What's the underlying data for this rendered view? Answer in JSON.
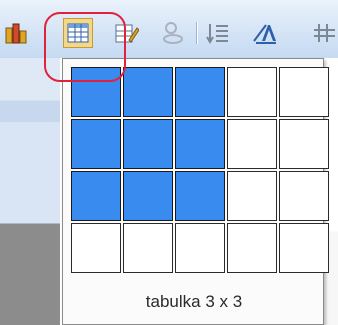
{
  "toolbar": {
    "buttons": [
      {
        "name": "chart-icon"
      },
      {
        "name": "insert-table-icon"
      },
      {
        "name": "draw-table-icon"
      },
      {
        "name": "hyperlink-icon"
      },
      {
        "name": "sort-icon"
      },
      {
        "name": "text-direction-icon"
      },
      {
        "name": "borders-icon"
      }
    ]
  },
  "table_picker": {
    "rows": 4,
    "cols": 5,
    "selected_rows": 3,
    "selected_cols": 3,
    "caption": "tabulka 3 x 3"
  },
  "colors": {
    "selected": "#3a8bf0",
    "highlight": "#e0233d"
  }
}
